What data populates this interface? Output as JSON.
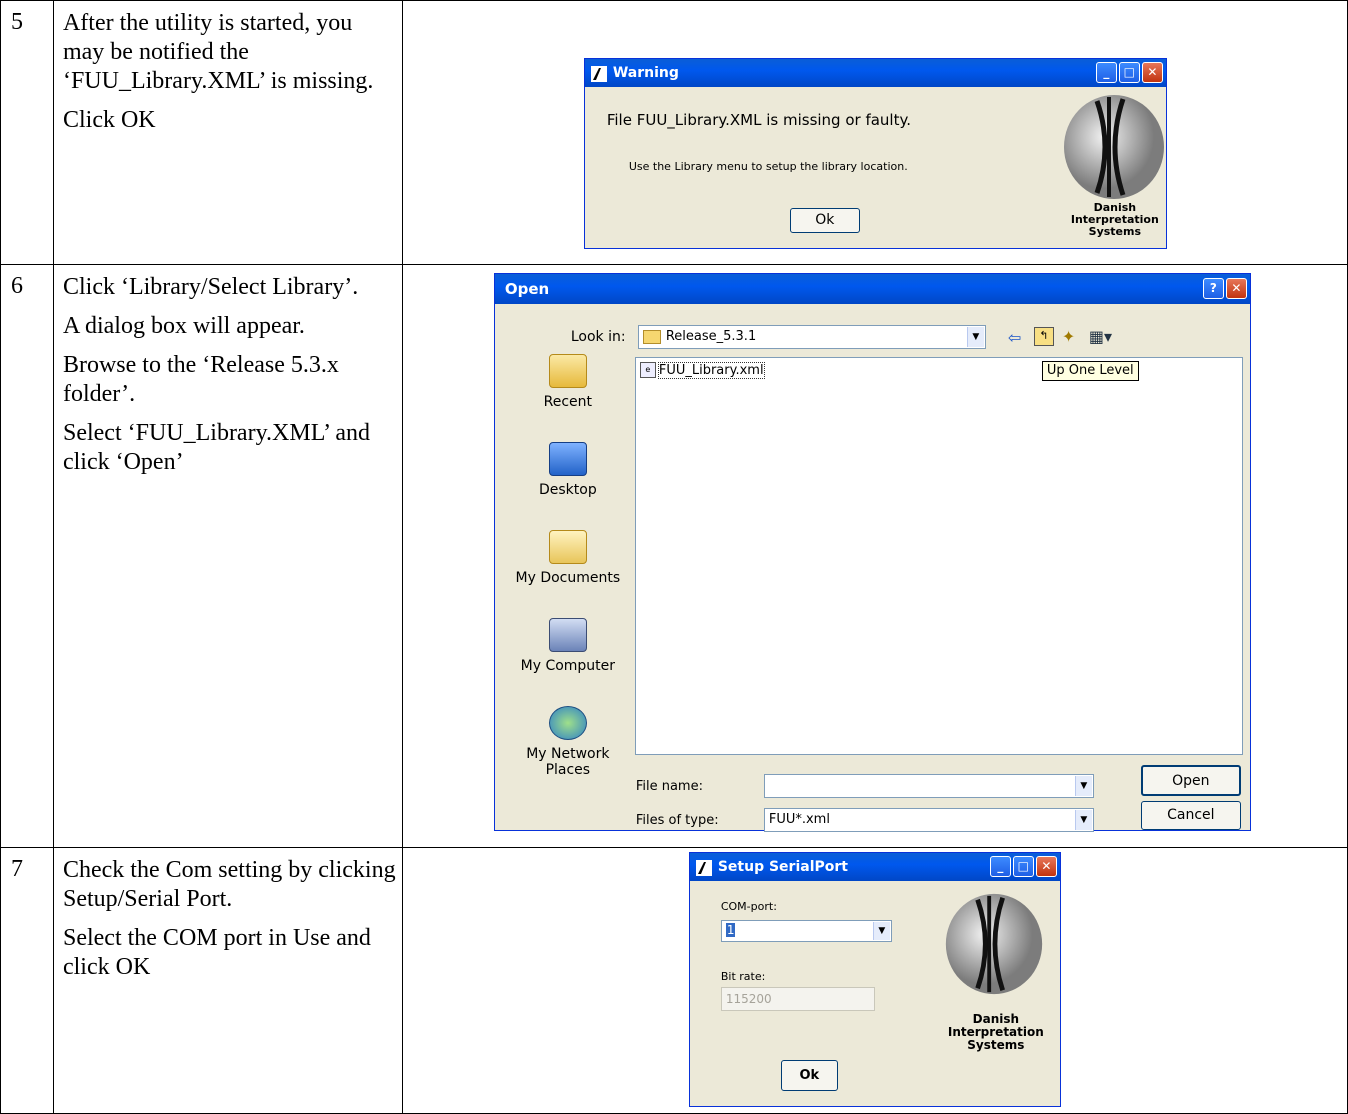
{
  "rows": [
    {
      "num": "5",
      "paras": [
        "After the utility is started, you may be notified the ‘FUU_Library.XML’ is missing.",
        "Click OK"
      ]
    },
    {
      "num": "6",
      "paras": [
        "Click ‘Library/Select Library’.",
        "A dialog box will appear.",
        "Browse to the ‘Release 5.3.x folder’.",
        "Select ‘FUU_Library.XML’ and click ‘Open’"
      ]
    },
    {
      "num": "7",
      "paras": [
        "Check the Com setting by clicking Setup/Serial Port.",
        "Select the COM port in Use and click OK"
      ]
    }
  ],
  "warning_dialog": {
    "title": "Warning",
    "message": "File FUU_Library.XML is missing or faulty.",
    "hint": "Use the Library menu to setup the library location.",
    "ok_label": "Ok",
    "logo_lines": [
      "Danish",
      "Interpretation",
      "Systems"
    ]
  },
  "open_dialog": {
    "title": "Open",
    "look_in_label": "Look in:",
    "look_in_value": "Release_5.3.1",
    "file_item": "FUU_Library.xml",
    "tooltip": "Up One Level",
    "places": [
      "Recent",
      "Desktop",
      "My Documents",
      "My Computer",
      "My Network Places"
    ],
    "file_name_label": "File name:",
    "file_name_value": "",
    "files_of_type_label": "Files of type:",
    "files_of_type_value": "FUU*.xml",
    "open_label": "Open",
    "cancel_label": "Cancel"
  },
  "serial_dialog": {
    "title": "Setup SerialPort",
    "com_label": "COM-port:",
    "com_value": "1",
    "bitrate_label": "Bit rate:",
    "bitrate_value": "115200",
    "ok_label": "Ok",
    "logo_lines": [
      "Danish",
      "Interpretation",
      "Systems"
    ]
  },
  "colors": {
    "titlebar": "#0058ee",
    "dialog_bg": "#ece9d8",
    "close_button": "#c1330f"
  }
}
